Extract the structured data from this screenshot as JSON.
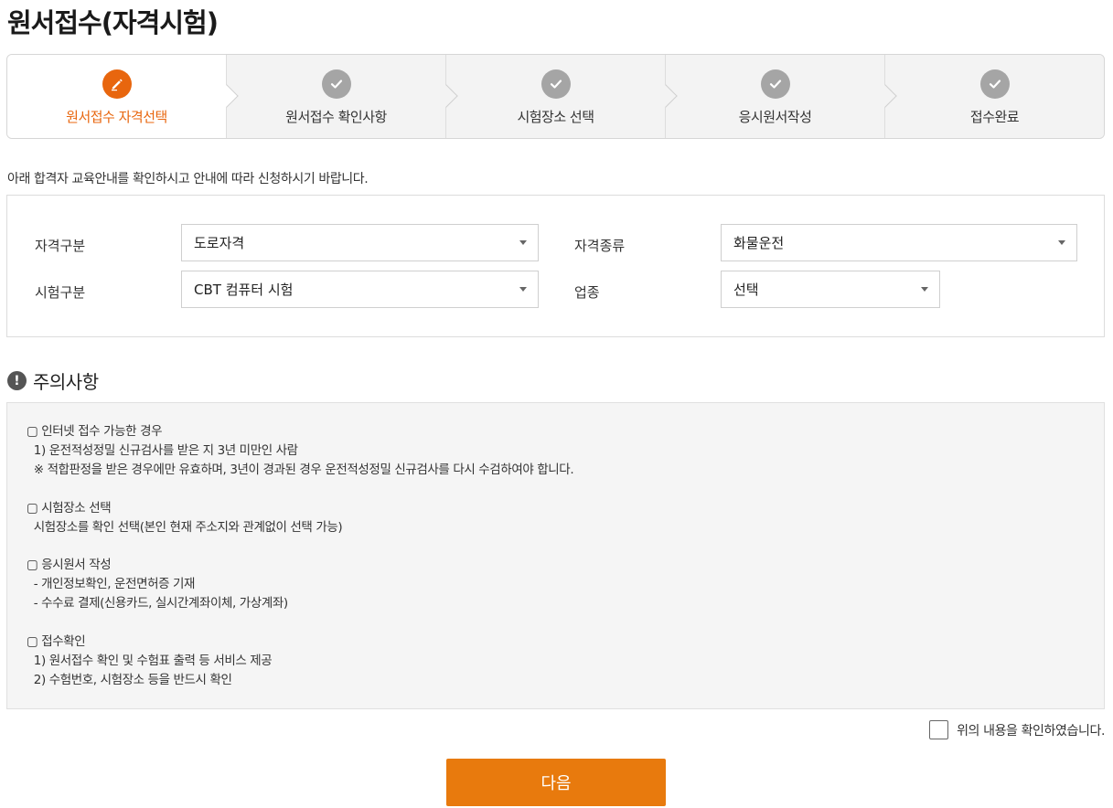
{
  "page": {
    "title": "원서접수(자격시험)"
  },
  "steps": [
    {
      "label": "원서접수 자격선택",
      "icon": "pencil-icon",
      "active": true
    },
    {
      "label": "원서접수 확인사항",
      "icon": "check-icon",
      "active": false
    },
    {
      "label": "시험장소 선택",
      "icon": "check-icon",
      "active": false
    },
    {
      "label": "응시원서작성",
      "icon": "check-icon",
      "active": false
    },
    {
      "label": "접수완료",
      "icon": "check-icon",
      "active": false
    }
  ],
  "guide_text": "아래 합격자 교육안내를 확인하시고 안내에 따라 신청하시기 바랍니다.",
  "form": {
    "qualification_category": {
      "label": "자격구분",
      "value": "도로자격"
    },
    "qualification_type": {
      "label": "자격종류",
      "value": "화물운전"
    },
    "exam_category": {
      "label": "시험구분",
      "value": "CBT 컴퓨터 시험"
    },
    "business_type": {
      "label": "업종",
      "value": "선택"
    }
  },
  "caution": {
    "title": "주의사항",
    "sections": [
      {
        "heading": "▢ 인터넷 접수 가능한 경우",
        "lines": [
          "  1) 운전적성정밀 신규검사를 받은 지 3년 미만인 사람",
          "  ※ 적합판정을 받은 경우에만 유효하며, 3년이 경과된 경우 운전적성정밀 신규검사를 다시 수검하여야 합니다."
        ]
      },
      {
        "heading": "▢ 시험장소 선택",
        "lines": [
          "  시험장소를 확인 선택(본인 현재 주소지와 관계없이 선택 가능)"
        ]
      },
      {
        "heading": "▢ 응시원서 작성",
        "lines": [
          "  - 개인정보확인, 운전면허증 기재",
          "  - 수수료 결제(신용카드, 실시간계좌이체, 가상계좌)"
        ]
      },
      {
        "heading": "▢ 접수확인",
        "lines": [
          "  1) 원서접수 확인 및 수험표 출력 등 서비스 제공",
          "  2) 수험번호, 시험장소 등을 반드시 확인"
        ]
      }
    ]
  },
  "agree_label": "위의 내용을 확인하였습니다.",
  "next_button": "다음",
  "colors": {
    "accent": "#e8660e",
    "button": "#e87a0d",
    "inactive_step": "#a5a5a5"
  }
}
